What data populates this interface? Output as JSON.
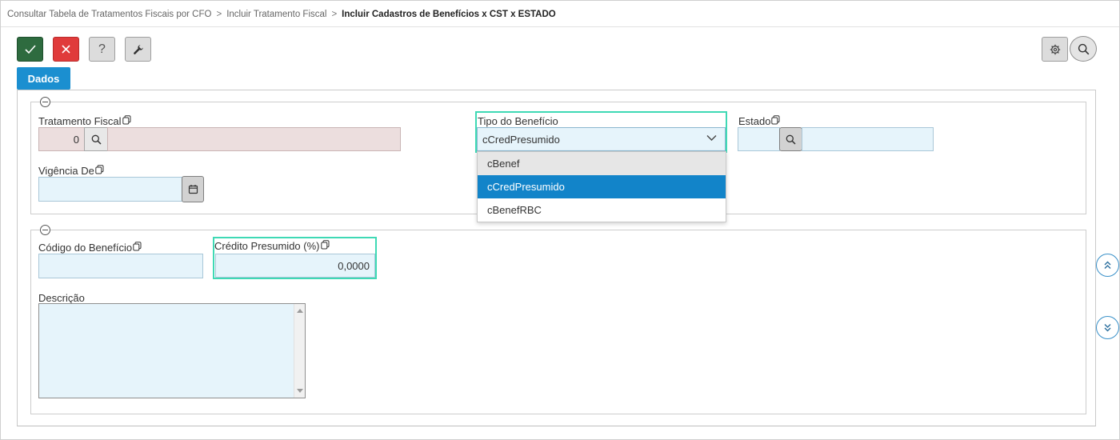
{
  "breadcrumb": {
    "items": [
      "Consultar Tabela de Tratamentos Fiscais por CFO",
      "Incluir Tratamento Fiscal"
    ],
    "separator": ">",
    "current": "Incluir Cadastros de Benefícios x CST x ESTADO"
  },
  "toolbar": {
    "help_label": "?"
  },
  "tabs": [
    {
      "label": "Dados",
      "active": true
    }
  ],
  "form": {
    "tratamento_fiscal": {
      "label": "Tratamento Fiscal",
      "value": "0",
      "description": ""
    },
    "tipo_beneficio": {
      "label": "Tipo do Benefício",
      "selected": "cCredPresumido",
      "options": [
        "cBenef",
        "cCredPresumido",
        "cBenefRBC"
      ],
      "hovered": "cBenef"
    },
    "estado": {
      "label": "Estado",
      "code": "",
      "name": ""
    },
    "vigencia_de": {
      "label": "Vigência De",
      "value": ""
    },
    "codigo_beneficio": {
      "label": "Código do Benefício",
      "value": ""
    },
    "credito_presumido": {
      "label": "Crédito Presumido (%)",
      "value": "0,0000"
    },
    "descricao": {
      "label": "Descrição",
      "value": ""
    }
  },
  "colors": {
    "primary": "#1b8fd0",
    "ok": "#2e6b3f",
    "cancel": "#e03b3b",
    "focus": "#3fd9b5",
    "input_bg": "#e6f4fb",
    "readonly_bg": "#ecdede",
    "option_selected": "#1284c9"
  },
  "icons": {
    "ok": "check-icon",
    "cancel": "close-icon",
    "tools": "wrench-icon",
    "settings": "gear-icon",
    "search": "search-icon",
    "calendar": "calendar-icon",
    "copy": "copy-icon",
    "scroll_up": "double-chevron-up-icon",
    "scroll_down": "double-chevron-down-icon"
  }
}
